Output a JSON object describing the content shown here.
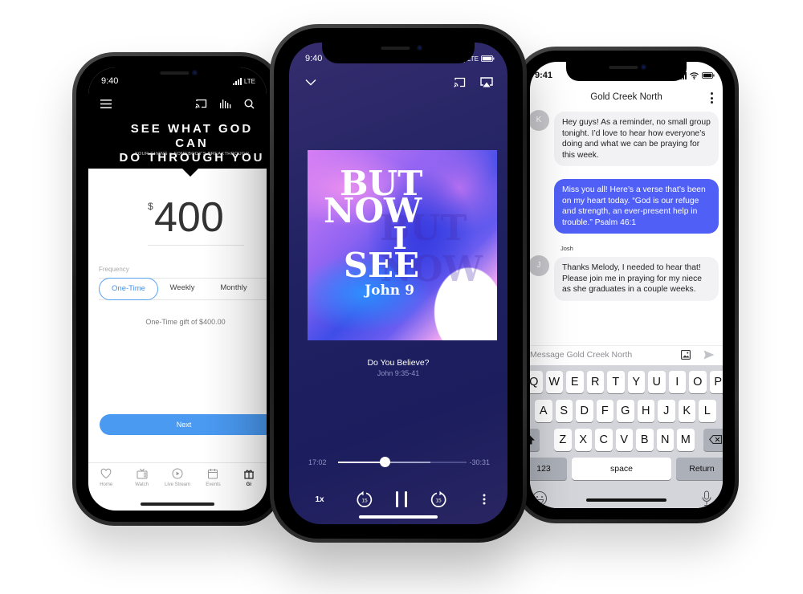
{
  "giving_app": {
    "status": {
      "time": "9:40",
      "network": "LTE"
    },
    "toolbar": {
      "icons": [
        "menu-icon",
        "cast-icon",
        "audio-bars-icon",
        "search-icon"
      ]
    },
    "hero": {
      "title_line1": "SEE WHAT GOD CAN",
      "title_line2": "DO THROUGH YOU",
      "subtitle": "YOUR GIVING = SOMEBODY'S BREAKTHROUGH"
    },
    "amount": {
      "currency": "$",
      "value": "400"
    },
    "frequency": {
      "label": "Frequency",
      "options": [
        "One-Time",
        "Weekly",
        "Monthly"
      ],
      "selected": "One-Time"
    },
    "summary": "One-Time gift of $400.00",
    "next_label": "Next",
    "tabbar": {
      "items": [
        {
          "label": "Home",
          "icon": "heart-icon"
        },
        {
          "label": "Watch",
          "icon": "tv-icon"
        },
        {
          "label": "Live Stream",
          "icon": "play-circle-icon"
        },
        {
          "label": "Events",
          "icon": "calendar-icon"
        },
        {
          "label": "Gi",
          "icon": "gift-icon"
        }
      ],
      "active": "Gi"
    }
  },
  "player_app": {
    "status": {
      "time": "9:40",
      "network": "LTE"
    },
    "artwork": {
      "lines": [
        "BUT",
        "NOW",
        "I",
        "SEE"
      ],
      "subtitle": "John 9",
      "ghost_text": "BUT NOW"
    },
    "track": {
      "title": "Do You Believe?",
      "reference": "John 9:35-41"
    },
    "progress": {
      "elapsed": "17:02",
      "remaining": "-30:31",
      "played_fraction": 0.36,
      "buffered_fraction": 0.72
    },
    "controls": {
      "speed": "1x",
      "skip_back_seconds": "15",
      "skip_forward_seconds": "15"
    },
    "colors": {
      "accent": "#1f2162"
    }
  },
  "chat_app": {
    "status": {
      "time": "9:41"
    },
    "header": {
      "title": "Gold Creek North"
    },
    "messages": [
      {
        "avatar": "K",
        "sender": "",
        "direction": "in",
        "text": "Hey guys! As a reminder, no small group tonight. I’d love to hear how everyone’s doing and what we can be praying for this week."
      },
      {
        "avatar": "",
        "sender": "",
        "direction": "out",
        "text": "Miss you all! Here’s a verse that’s been on my heart today. “God is our refuge and strength, an ever-present help in trouble.” Psalm 46:1"
      },
      {
        "avatar": "J",
        "sender": "Josh",
        "direction": "in",
        "text": "Thanks Melody, I needed to hear that! Please join me in praying for my niece as she graduates in a couple weeks."
      }
    ],
    "composer": {
      "placeholder": "Message Gold Creek North"
    },
    "keyboard": {
      "row1": [
        "Q",
        "W",
        "E",
        "R",
        "T",
        "Y",
        "U",
        "I",
        "O",
        "P"
      ],
      "row2": [
        "A",
        "S",
        "D",
        "F",
        "G",
        "H",
        "J",
        "K",
        "L"
      ],
      "row3": [
        "Z",
        "X",
        "C",
        "V",
        "B",
        "N",
        "M"
      ],
      "numbers": "123",
      "space": "space",
      "return": "Return"
    },
    "colors": {
      "outgoing_bubble": "#5060f6",
      "incoming_bubble": "#f2f2f5"
    }
  }
}
